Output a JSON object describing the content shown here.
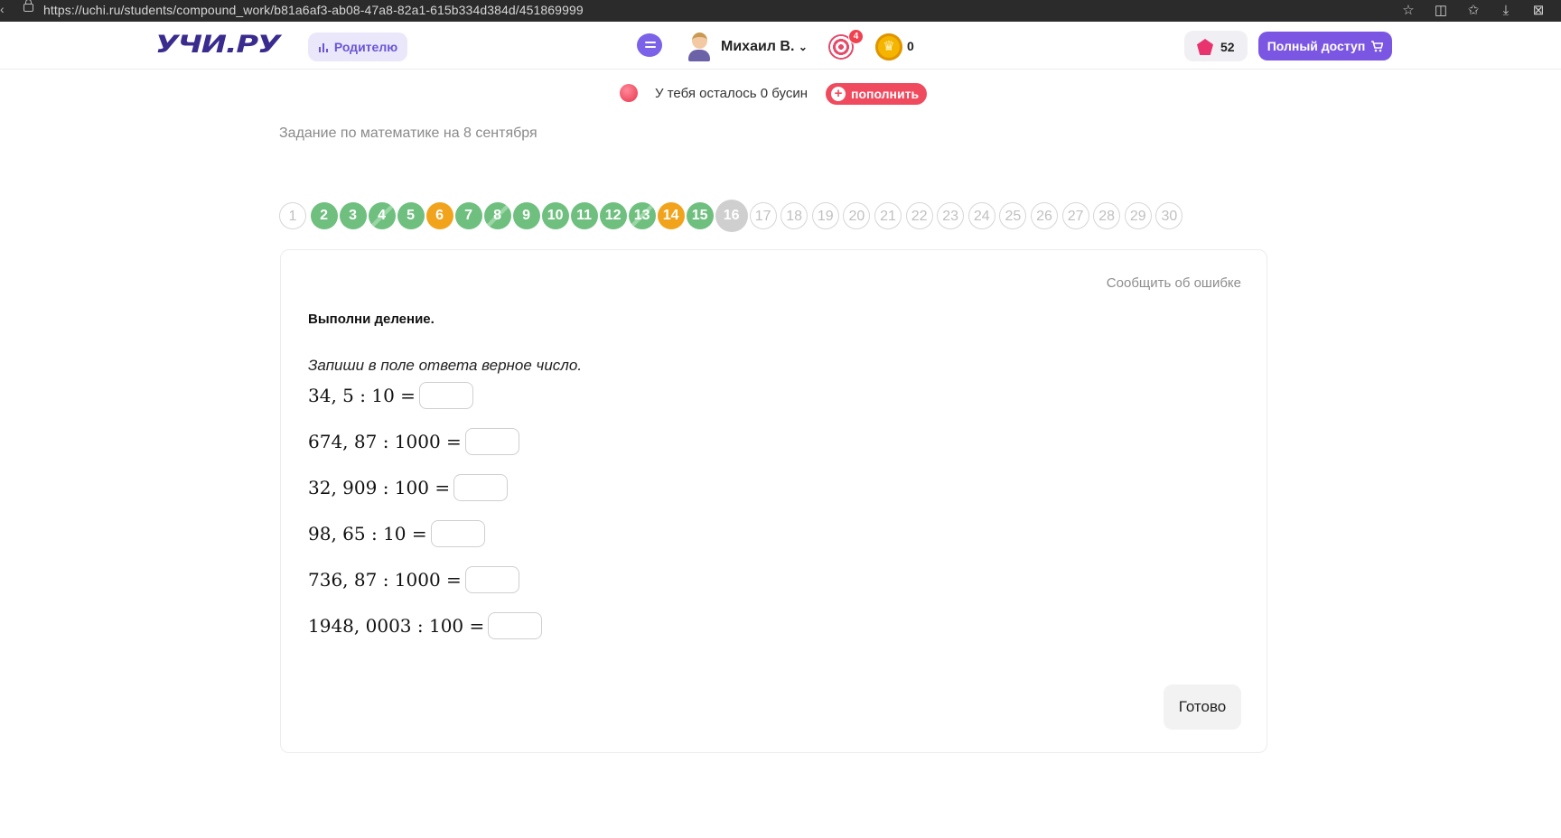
{
  "browser": {
    "url": "https://uchi.ru/students/compound_work/b81a6af3-ab08-47a8-82a1-615b334d384d/451869999"
  },
  "header": {
    "logo": "УЧИ.РУ",
    "parent_label": "Родителю",
    "user_name": "Михаил В.",
    "target_badge": "4",
    "crowns": "0",
    "gems": "52",
    "full_access_label": "Полный доступ"
  },
  "beads": {
    "text": "У тебя осталось 0 бусин",
    "refill_label": "пополнить"
  },
  "task_title": "Задание по математике на 8 сентября",
  "progress": {
    "current": 16,
    "steps": [
      {
        "n": "1",
        "state": "todo"
      },
      {
        "n": "2",
        "state": "done"
      },
      {
        "n": "3",
        "state": "done"
      },
      {
        "n": "4",
        "state": "half"
      },
      {
        "n": "5",
        "state": "done"
      },
      {
        "n": "6",
        "state": "warn"
      },
      {
        "n": "7",
        "state": "done"
      },
      {
        "n": "8",
        "state": "half"
      },
      {
        "n": "9",
        "state": "done"
      },
      {
        "n": "10",
        "state": "done"
      },
      {
        "n": "11",
        "state": "done"
      },
      {
        "n": "12",
        "state": "done"
      },
      {
        "n": "13",
        "state": "half"
      },
      {
        "n": "14",
        "state": "warn"
      },
      {
        "n": "15",
        "state": "done"
      },
      {
        "n": "16",
        "state": "current"
      },
      {
        "n": "17",
        "state": "todo"
      },
      {
        "n": "18",
        "state": "todo"
      },
      {
        "n": "19",
        "state": "todo"
      },
      {
        "n": "20",
        "state": "todo"
      },
      {
        "n": "21",
        "state": "todo"
      },
      {
        "n": "22",
        "state": "todo"
      },
      {
        "n": "23",
        "state": "todo"
      },
      {
        "n": "24",
        "state": "todo"
      },
      {
        "n": "25",
        "state": "todo"
      },
      {
        "n": "26",
        "state": "todo"
      },
      {
        "n": "27",
        "state": "todo"
      },
      {
        "n": "28",
        "state": "todo"
      },
      {
        "n": "29",
        "state": "todo"
      },
      {
        "n": "30",
        "state": "todo"
      }
    ]
  },
  "card": {
    "report_label": "Сообщить об ошибке",
    "heading": "Выполни деление.",
    "hint": "Запиши в поле ответа верное число.",
    "expressions": [
      {
        "text": "34, 5 : 10 =",
        "value": ""
      },
      {
        "text": "674, 87 : 1000 =",
        "value": ""
      },
      {
        "text": "32, 909 : 100 =",
        "value": ""
      },
      {
        "text": "98, 65 : 10 =",
        "value": ""
      },
      {
        "text": "736, 87 : 1000 =",
        "value": ""
      },
      {
        "text": "1948, 0003 : 100 =",
        "value": ""
      }
    ],
    "done_label": "Готово"
  },
  "colors": {
    "brand": "#3a2b8f",
    "accent": "#7b56e2",
    "done": "#6fbf7f",
    "warn": "#f2a31c",
    "alert": "#f04a5e"
  },
  "icons": [
    "lock-icon",
    "star-icon",
    "split-view-icon",
    "favorites-icon",
    "download-icon",
    "extensions-icon",
    "chat-icon",
    "target-icon",
    "crown-coin-icon",
    "gem-icon",
    "cart-icon",
    "bar-chart-icon",
    "plus-icon"
  ]
}
